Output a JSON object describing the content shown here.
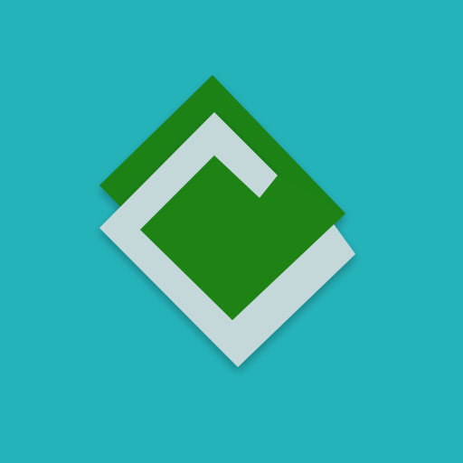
{
  "colors": {
    "background": "#25B3BA",
    "front_square": "#1E8215",
    "frame": "#C4D8DA",
    "shadow": "#000000"
  },
  "icons": {
    "logo": "diamond-frame-logo-icon"
  }
}
